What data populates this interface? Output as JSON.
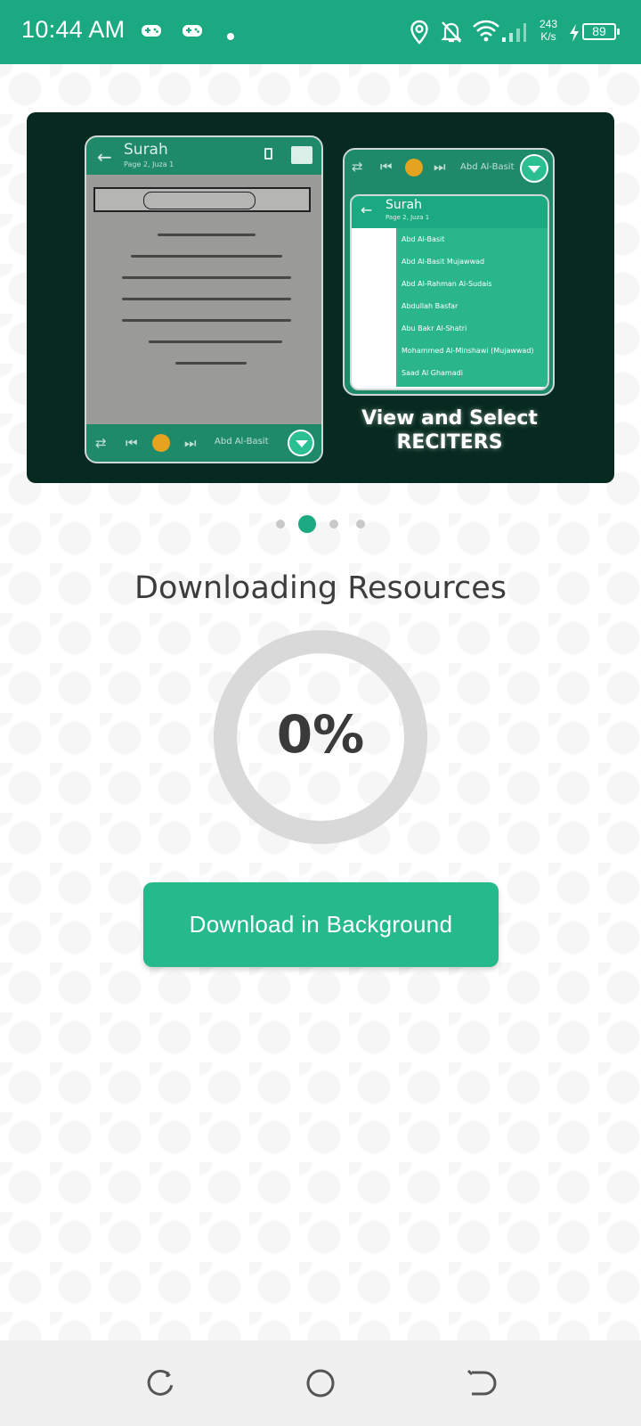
{
  "status_bar": {
    "time": "10:44 AM",
    "net_speed_value": "243",
    "net_speed_unit": "K/s",
    "battery": "89",
    "icons": [
      "gamepad-icon",
      "gamepad-icon",
      "dot-icon",
      "location-icon",
      "bell-off-icon",
      "wifi-icon",
      "signal-icon",
      "charging-icon",
      "battery-icon"
    ],
    "bg_color": "#1aa981"
  },
  "banner": {
    "left_phone": {
      "title": "Surah",
      "subtitle": "Page 2, Juza 1",
      "reciter": "Abd Al-Basit"
    },
    "right_phone": {
      "top_reciter": "Abd Al-Basit",
      "title": "Surah",
      "subtitle": "Page 2, Juza 1",
      "reciters": [
        "Abd Al-Basit",
        "Abd Al-Basit Mujawwad",
        "Abd Al-Rahman Al-Sudais",
        "Abdullah Basfar",
        "Abu Bakr Al-Shatri",
        "Mohammed Al-Minshawi (Mujawwad)",
        "Saad Al Ghamadi"
      ]
    },
    "caption_line1": "View and Select",
    "caption_line2": "RECITERS"
  },
  "carousel": {
    "count": 4,
    "active_index": 1
  },
  "download": {
    "title": "Downloading Resources",
    "progress_label": "0%",
    "progress": 0,
    "button_label": "Download in Background"
  },
  "accent_color": "#1aa981",
  "nav_bar": {
    "items": [
      "recent-apps-icon",
      "home-icon",
      "back-icon"
    ]
  }
}
